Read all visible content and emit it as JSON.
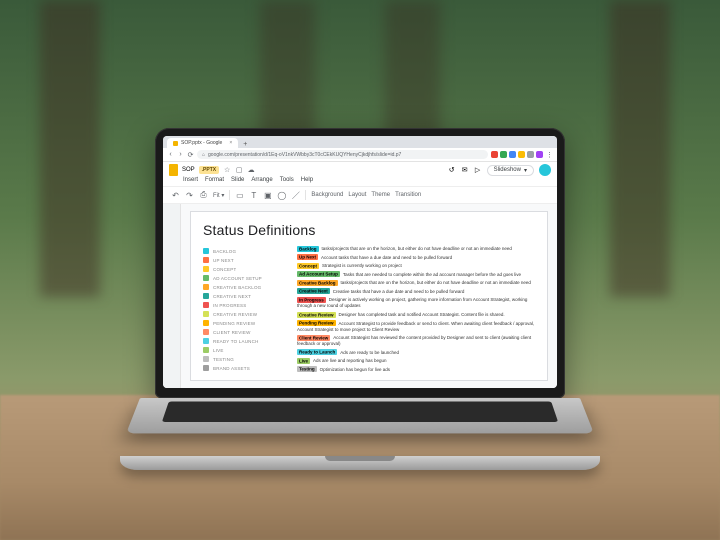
{
  "browser": {
    "tab_title": "SOP.pptx - Google",
    "new_tab_glyph": "+",
    "url": "google.com/presentation/d/1Eq-oV1nkVWbby3cT0cCEkKUQYHenyCjkdjhfs/slide=id.p7",
    "lock_glyph": "⌂",
    "extensions": [
      "e1",
      "e2",
      "e3",
      "e4",
      "e5",
      "e6"
    ]
  },
  "app": {
    "doc_title": "SOP",
    "ext_badge": ".PPTX",
    "star_glyph": "☆",
    "move_glyph": "▢",
    "cloud_glyph": "☁",
    "history_glyph": "↺",
    "chat_glyph": "✉",
    "present_glyph": "▷",
    "slideshow_label": "Slideshow",
    "dropdown_glyph": "▾",
    "menus": [
      "Insert",
      "Format",
      "Slide",
      "Arrange",
      "Tools",
      "Help"
    ],
    "toolbar": {
      "undo": "↶",
      "redo": "↷",
      "print": "⎙",
      "zoom_label": "Fit",
      "zoom_caret": "▾",
      "pointer": "▭",
      "textbox": "T",
      "image": "▣",
      "shape": "◯",
      "line": "／",
      "background": "Background",
      "layout": "Layout",
      "theme": "Theme",
      "transition": "Transition"
    }
  },
  "slide": {
    "title": "Status Definitions"
  },
  "statuses": [
    {
      "name": "Backlog",
      "color": "#26c6da",
      "desc": "tasks/projects that are on the horizon, but either do not have deadline or not an immediate need"
    },
    {
      "name": "Up Next",
      "color": "#ff7043",
      "desc": "Account tasks that have a due date and need to be pulled forward"
    },
    {
      "name": "Concept",
      "color": "#ffca28",
      "desc": "Strategist is currently working on project"
    },
    {
      "name": "Ad Account Setup",
      "color": "#66bb6a",
      "desc": "Tasks that are needed to complete within the ad account manager before the ad goes live"
    },
    {
      "name": "Creative Backlog",
      "color": "#ffa726",
      "desc": "tasks/projects that are on the horizon, but either do not have deadline or not an immediate need"
    },
    {
      "name": "Creative Next",
      "color": "#26a69a",
      "desc": "Creative tasks that have a due date and need to be pulled forward"
    },
    {
      "name": "In Progress",
      "color": "#ef5350",
      "desc": "Designer is actively working on project, gathering more information from Account Strategist, working through a new round of updates"
    },
    {
      "name": "Creative Review",
      "color": "#d4e157",
      "desc": "Designer has completed task and notified Account Strategist. Content file is shared."
    },
    {
      "name": "Pending Review",
      "color": "#ffb300",
      "desc": "Account Strategist to provide feedback or send to client. When awaiting client feedback / approval, Account Strategist to move project to Client Review"
    },
    {
      "name": "Client Review",
      "color": "#ff8a65",
      "desc": "Account Strategist has reviewed the content provided by Designer and sent to client (awaiting client feedback or approval)"
    },
    {
      "name": "Ready to Launch",
      "color": "#4dd0e1",
      "desc": "Ads are ready to be launched"
    },
    {
      "name": "Live",
      "color": "#9ccc65",
      "desc": "Ads are live and reporting has begun"
    },
    {
      "name": "Testing",
      "color": "#bdbdbd",
      "desc": "Optimization has begun for live ads"
    }
  ],
  "legend_extra": [
    {
      "name": "BRAND ASSETS",
      "color": "#9e9e9e"
    }
  ]
}
